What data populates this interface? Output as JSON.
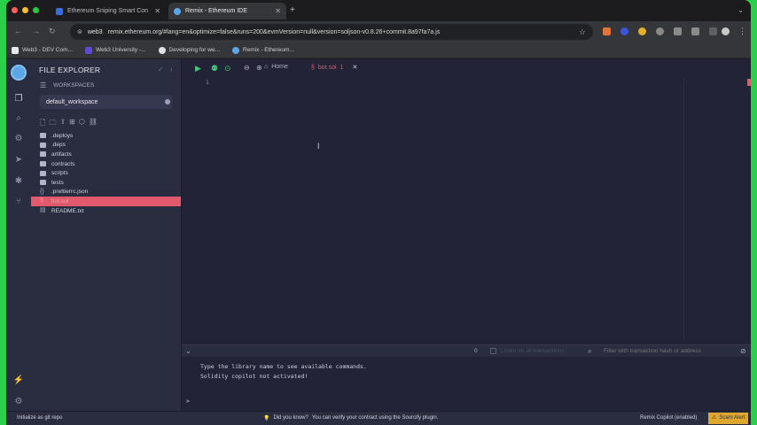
{
  "browser": {
    "tabs": [
      {
        "title": "Ethereum Sniping Smart Con",
        "favicon_color": "#3b6de0",
        "active": false
      },
      {
        "title": "Remix - Ethereum IDE",
        "favicon_color": "#5aa6e6",
        "active": true
      }
    ],
    "new_tab_icon": "plus-icon",
    "address": {
      "site_chip": "web3",
      "url": "remix.ethereum.org/#lang=en&optimize=false&runs=200&evmVersion=null&version=soljson-v0.8.26+commit.8a97fa7a.js"
    },
    "bookmarks": [
      {
        "label": "Web3 - DEV Com...",
        "color": "#e8e8e8"
      },
      {
        "label": "Web3 University -...",
        "color": "#5b4bd8"
      },
      {
        "label": "Developing for we...",
        "color": "#e0e0e0"
      },
      {
        "label": "Remix - Ethereum...",
        "color": "#5aa6e6"
      }
    ]
  },
  "remix": {
    "side_panel": {
      "title": "FILE EXPLORER",
      "workspaces_label": "WORKSPACES",
      "workspace_selected": "default_workspace",
      "tree": [
        {
          "name": ".deploys",
          "type": "folder"
        },
        {
          "name": ".deps",
          "type": "folder"
        },
        {
          "name": "artifacts",
          "type": "folder"
        },
        {
          "name": "contracts",
          "type": "folder"
        },
        {
          "name": "scripts",
          "type": "folder"
        },
        {
          "name": "tests",
          "type": "folder"
        },
        {
          "name": ".prettierrc.json",
          "type": "file"
        },
        {
          "name": "bot.sol",
          "type": "file",
          "active": true
        },
        {
          "name": "README.txt",
          "type": "file"
        }
      ]
    },
    "main_tabs": {
      "home_label": "Home",
      "file_label": "bot.sol",
      "file_badge": "1"
    },
    "editor": {
      "line_number": "1"
    },
    "terminal": {
      "tx_count": "0",
      "listen_label": "Listen on all transactions",
      "filter_placeholder": "Filter with transaction hash or address",
      "lines": [
        "Type the library name to see available commands.",
        "Solidity copilot not activated!"
      ],
      "prompt": ">"
    },
    "status_bar": {
      "left": "Initialize as git repo",
      "tip_prefix": "Did you know?",
      "tip_text": "You can verify your contract using the Sourcify plugin.",
      "copilot": "Remix Copilot (enabled)",
      "scam_alert": "Scam Alert"
    }
  },
  "colors": {
    "accent": "#e05a6c",
    "run": "#46c373",
    "scam": "#e0a72f"
  }
}
